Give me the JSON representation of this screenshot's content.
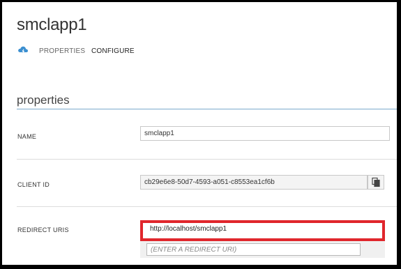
{
  "app": {
    "title": "smclapp1"
  },
  "tabs": [
    {
      "label": "PROPERTIES"
    },
    {
      "label": "CONFIGURE"
    }
  ],
  "properties": {
    "section_title": "properties",
    "name": {
      "label": "NAME",
      "value": "smclapp1"
    },
    "client_id": {
      "label": "CLIENT ID",
      "value": "cb29e6e8-50d7-4593-a051-c8553ea1cf6b"
    },
    "redirect_uris": {
      "label": "REDIRECT URIS",
      "value": "http://localhost/smclapp1",
      "placeholder": "(ENTER A REDIRECT URI)"
    }
  },
  "colors": {
    "accent_rule": "#7aa9cc",
    "highlight": "#e0262c",
    "icon_blue": "#3b8fd0"
  },
  "icons": {
    "app_icon": "cloud-lightning-icon",
    "copy_icon": "copy-icon"
  }
}
